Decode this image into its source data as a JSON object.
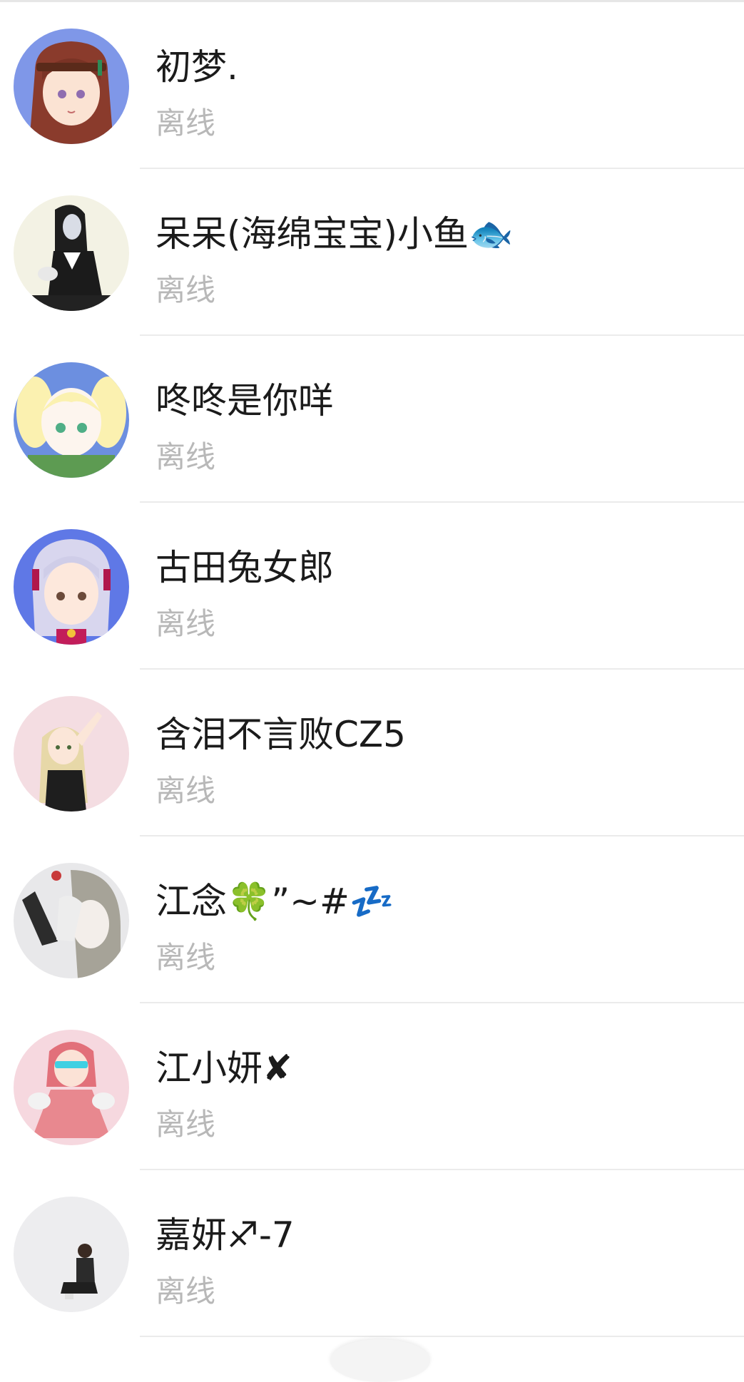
{
  "contacts": [
    {
      "name": "初梦.",
      "status": "离线",
      "avatar_icon": "anime-girl-headband-avatar"
    },
    {
      "name": "呆呆(海绵宝宝)小鱼🐟",
      "status": "离线",
      "avatar_icon": "anime-girl-dark-dress-avatar"
    },
    {
      "name": "咚咚是你咩",
      "status": "离线",
      "avatar_icon": "anime-girl-blonde-avatar"
    },
    {
      "name": "古田兔女郎",
      "status": "离线",
      "avatar_icon": "anime-girl-silver-hair-avatar"
    },
    {
      "name": "含泪不言败CZ5",
      "status": "离线",
      "avatar_icon": "anime-girl-waving-avatar"
    },
    {
      "name": "江念🍀”~#💤",
      "status": "离线",
      "avatar_icon": "anime-girl-gray-avatar"
    },
    {
      "name": "江小妍✘",
      "status": "离线",
      "avatar_icon": "anime-girl-pink-dress-avatar"
    },
    {
      "name": "嘉妍♐-7",
      "status": "离线",
      "avatar_icon": "sitting-figure-avatar"
    }
  ],
  "colors": {
    "name_text": "#1b1b1b",
    "status_text": "#b8b8b8",
    "divider": "#ebebeb"
  }
}
